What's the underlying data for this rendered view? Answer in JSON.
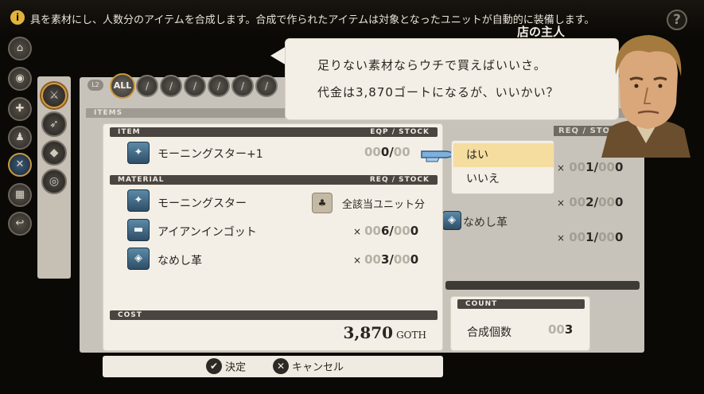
{
  "info": {
    "text": "具を素材にし、人数分のアイテムを合成します。合成で作られたアイテムは対象となったユニットが自動的に装備します。",
    "help": "?"
  },
  "filters": {
    "l2": "L2",
    "all": "ALL"
  },
  "background_list": {
    "items_header": "ITEMS",
    "eq_header": "EQ",
    "req_header": "REQ / STOCK",
    "rows": [
      {
        "label": "",
        "x": "×",
        "pad": "00",
        "have": "1",
        "sep": "/",
        "pad2": "00",
        "total": "0"
      },
      {
        "label": "",
        "x": "×",
        "pad": "00",
        "have": "2",
        "sep": "/",
        "pad2": "00",
        "total": "0"
      },
      {
        "label": "なめし革",
        "x": "",
        "pad": "",
        "have": "",
        "sep": "",
        "pad2": "",
        "total": ""
      },
      {
        "label": "",
        "x": "×",
        "pad": "00",
        "have": "1",
        "sep": "/",
        "pad2": "00",
        "total": "0"
      }
    ]
  },
  "dialog": {
    "item_header": "ITEM",
    "item_header_right": "EQP / STOCK",
    "item": {
      "name": "モーニングスター+1",
      "pad": "00",
      "value": "0",
      "sep": "/",
      "pad2": "00"
    },
    "material_header": "MATERIAL",
    "material_header_right": "REQ / STOCK",
    "materials": [
      {
        "name": "モーニングスター",
        "note": "全該当ユニット分"
      },
      {
        "name": "アイアンインゴット",
        "x": "×",
        "pad": "00",
        "req": "6",
        "sep": "/",
        "pad2": "00",
        "stock": "0"
      },
      {
        "name": "なめし革",
        "x": "×",
        "pad": "00",
        "req": "3",
        "sep": "/",
        "pad2": "00",
        "stock": "0"
      }
    ],
    "cost_header": "COST",
    "cost_value": "3,870",
    "cost_unit": "GOTH"
  },
  "footer": {
    "confirm": "決定",
    "cancel": "キャンセル"
  },
  "bubble": {
    "speaker": "店の主人",
    "line1": "足りない素材ならウチで買えばいいさ。",
    "line2": "代金は3,870ゴートになるが、いいかい？"
  },
  "choices": {
    "yes": "はい",
    "no": "いいえ"
  },
  "count": {
    "header": "COUNT",
    "label": "合成個数",
    "pad": "00",
    "value": "3"
  },
  "colors": {
    "accent_gold": "#c89a3c",
    "selection": "#f5dda0",
    "dark_bar": "#4a4540",
    "paper": "#f3efe6"
  }
}
